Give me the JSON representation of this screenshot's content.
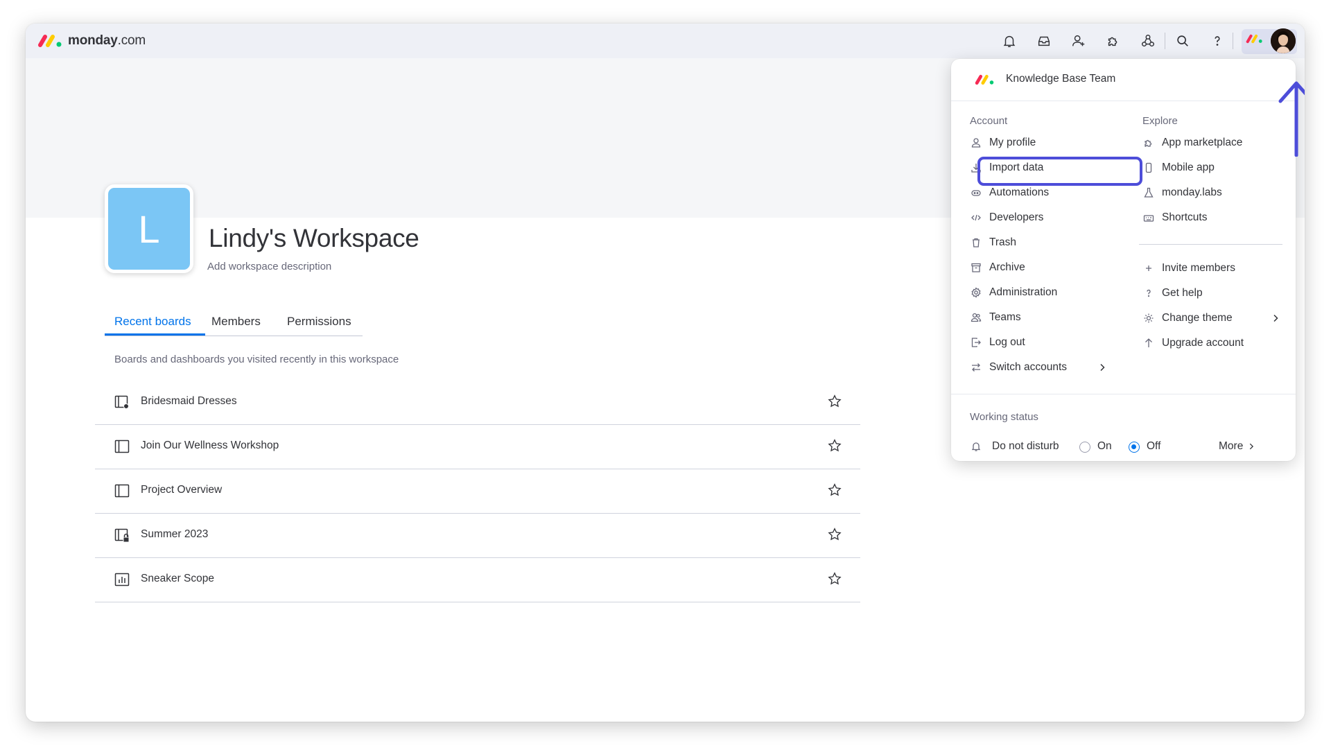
{
  "brand": {
    "name_bold": "monday",
    "name_suffix": ".com"
  },
  "topbar": {
    "icons": [
      "notifications-icon",
      "inbox-icon",
      "invite-members-icon",
      "apps-icon",
      "integrations-icon",
      "search-icon",
      "help-icon"
    ]
  },
  "workspace": {
    "initial": "L",
    "title": "Lindy's Workspace",
    "description_placeholder": "Add workspace description",
    "tile_color": "#7bc6f5"
  },
  "tabs": [
    {
      "label": "Recent boards",
      "active": true
    },
    {
      "label": "Members",
      "active": false
    },
    {
      "label": "Permissions",
      "active": false
    }
  ],
  "recent_note": "Boards and dashboards you visited recently in this workspace",
  "boards": [
    {
      "name": "Bridesmaid Dresses",
      "icon": "shared-board-icon"
    },
    {
      "name": "Join Our Wellness Workshop",
      "icon": "board-icon"
    },
    {
      "name": "Project Overview",
      "icon": "board-icon"
    },
    {
      "name": "Summer 2023",
      "icon": "private-board-icon"
    },
    {
      "name": "Sneaker Scope",
      "icon": "dashboard-icon"
    }
  ],
  "menu": {
    "team": "Knowledge Base Team",
    "account_label": "Account",
    "explore_label": "Explore",
    "account_items": [
      {
        "label": "My profile",
        "icon": "person-icon"
      },
      {
        "label": "Import data",
        "icon": "download-icon"
      },
      {
        "label": "Automations",
        "icon": "robot-icon"
      },
      {
        "label": "Developers",
        "icon": "code-icon"
      },
      {
        "label": "Trash",
        "icon": "trash-icon"
      },
      {
        "label": "Archive",
        "icon": "archive-icon"
      },
      {
        "label": "Administration",
        "icon": "settings-icon"
      },
      {
        "label": "Teams",
        "icon": "team-icon"
      },
      {
        "label": "Log out",
        "icon": "logout-icon"
      },
      {
        "label": "Switch accounts",
        "icon": "switch-icon"
      }
    ],
    "explore_items": [
      {
        "label": "App marketplace",
        "icon": "puzzle-icon"
      },
      {
        "label": "Mobile app",
        "icon": "mobile-icon"
      },
      {
        "label": "monday.labs",
        "icon": "flask-icon"
      },
      {
        "label": "Shortcuts",
        "icon": "keyboard-icon"
      }
    ],
    "explore_items_2": [
      {
        "label": "Invite members",
        "icon": "plus-icon"
      },
      {
        "label": "Get help",
        "icon": "help-icon"
      },
      {
        "label": "Change theme",
        "icon": "theme-icon"
      },
      {
        "label": "Upgrade account",
        "icon": "upgrade-icon"
      }
    ],
    "working_status_label": "Working status",
    "dnd_label": "Do not disturb",
    "on_label": "On",
    "off_label": "Off",
    "dnd_selected": "Off",
    "more_label": "More"
  },
  "colors": {
    "accent": "#0073ea",
    "highlight": "#4d4dd9",
    "topbar": "#eef0f6"
  }
}
